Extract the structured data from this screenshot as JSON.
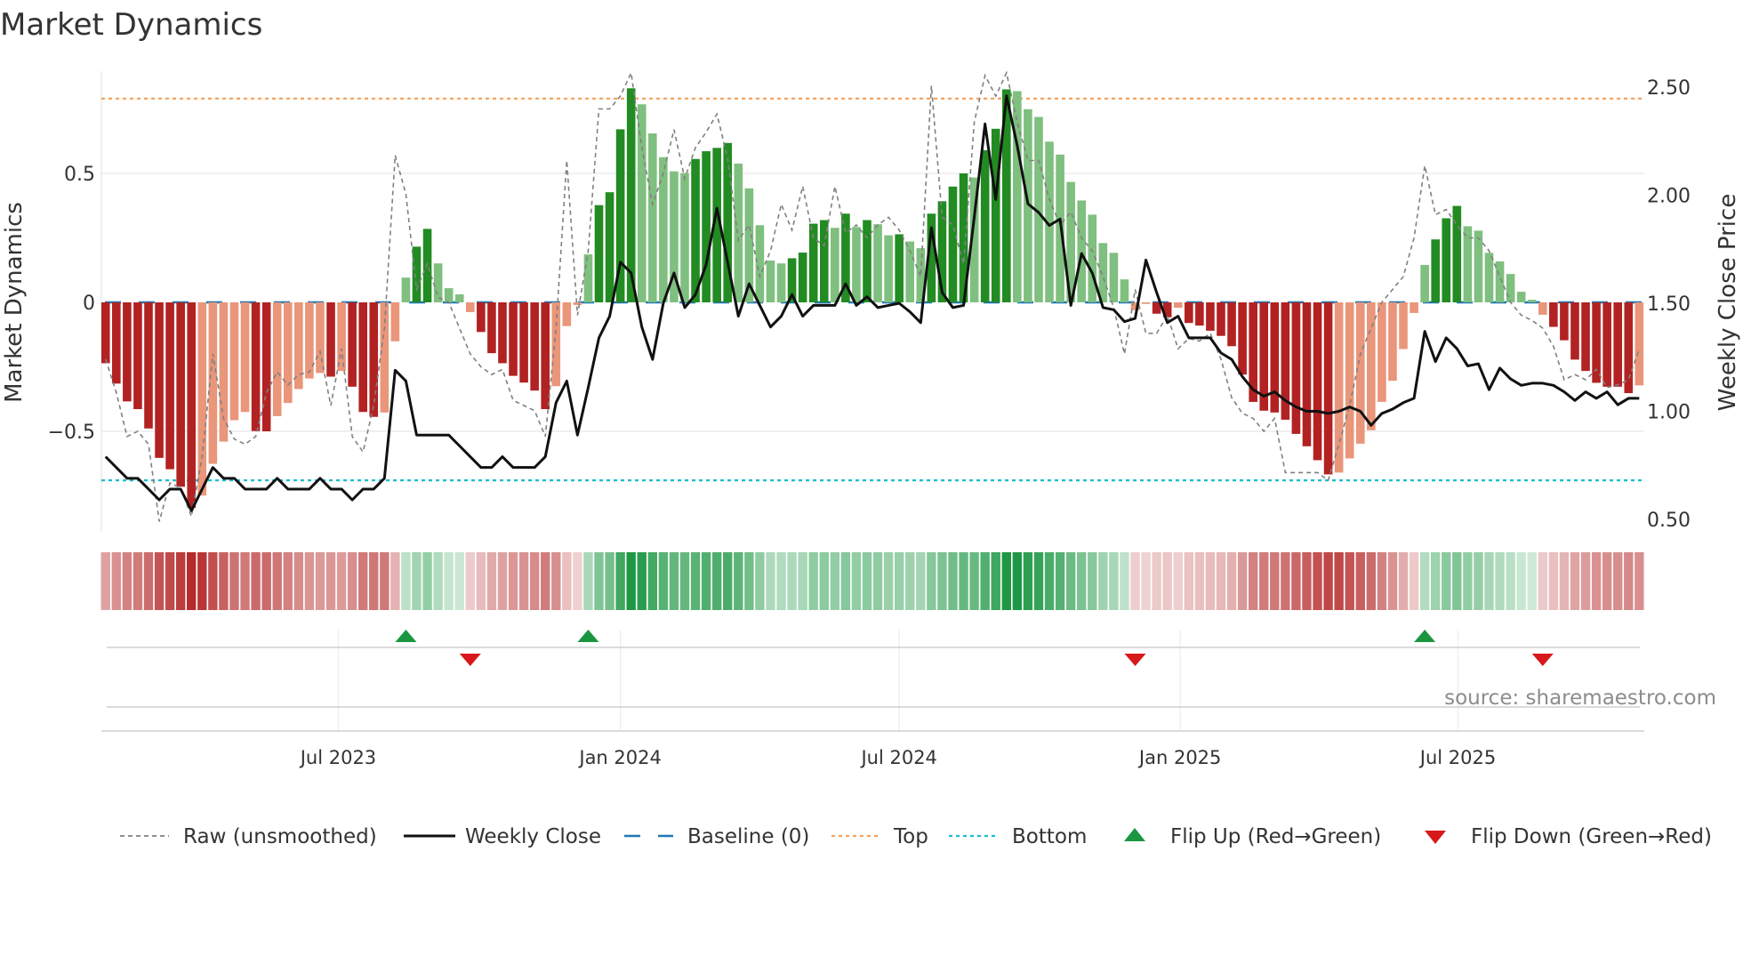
{
  "chart_data": {
    "type": "bar",
    "title": "Market Dynamics",
    "ylabel": "Market Dynamics",
    "y2label": "Weekly Close Price",
    "ylim": [
      -0.89,
      0.9
    ],
    "y2lim": [
      0.445,
      2.58
    ],
    "yticks": [
      {
        "label": "0.5",
        "value": 0.5
      },
      {
        "label": "0",
        "value": 0
      },
      {
        "label": "−0.5",
        "value": -0.5
      }
    ],
    "y2ticks": [
      {
        "label": "2.50",
        "value": 2.5
      },
      {
        "label": "2.00",
        "value": 2.0
      },
      {
        "label": "1.50",
        "value": 1.5
      },
      {
        "label": "1.00",
        "value": 1.0
      },
      {
        "label": "0.50",
        "value": 0.5
      }
    ],
    "xticks": [
      {
        "label": "Jul 2023",
        "week": 21.7
      },
      {
        "label": "Jan 2024",
        "week": 48.0
      },
      {
        "label": "Jul 2024",
        "week": 74.0
      },
      {
        "label": "Jan 2025",
        "week": 100.2
      },
      {
        "label": "Jul 2025",
        "week": 126.1
      }
    ],
    "grid": true,
    "top_level": 0.79,
    "bottom_level": -0.69,
    "baseline": 0,
    "dynamics": [
      -0.236,
      -0.315,
      -0.384,
      -0.414,
      -0.489,
      -0.603,
      -0.647,
      -0.715,
      -0.797,
      -0.749,
      -0.626,
      -0.54,
      -0.457,
      -0.425,
      -0.499,
      -0.5,
      -0.441,
      -0.39,
      -0.336,
      -0.295,
      -0.274,
      -0.288,
      -0.266,
      -0.327,
      -0.425,
      -0.444,
      -0.427,
      -0.151,
      0.096,
      0.216,
      0.285,
      0.151,
      0.055,
      0.031,
      -0.038,
      -0.115,
      -0.197,
      -0.236,
      -0.285,
      -0.311,
      -0.342,
      -0.414,
      -0.325,
      -0.092,
      -0.01,
      0.186,
      0.377,
      0.427,
      0.671,
      0.83,
      0.768,
      0.655,
      0.563,
      0.508,
      0.501,
      0.556,
      0.586,
      0.599,
      0.618,
      0.538,
      0.442,
      0.299,
      0.162,
      0.151,
      0.171,
      0.193,
      0.305,
      0.319,
      0.289,
      0.344,
      0.292,
      0.319,
      0.303,
      0.26,
      0.264,
      0.236,
      0.21,
      0.344,
      0.392,
      0.449,
      0.5,
      0.484,
      0.59,
      0.673,
      0.826,
      0.819,
      0.749,
      0.719,
      0.623,
      0.573,
      0.467,
      0.395,
      0.34,
      0.23,
      0.192,
      0.089,
      -0.03,
      -0.006,
      -0.044,
      -0.058,
      -0.021,
      -0.08,
      -0.09,
      -0.11,
      -0.13,
      -0.17,
      -0.28,
      -0.386,
      -0.42,
      -0.427,
      -0.455,
      -0.51,
      -0.558,
      -0.612,
      -0.667,
      -0.66,
      -0.605,
      -0.548,
      -0.496,
      -0.386,
      -0.304,
      -0.181,
      -0.041,
      0.145,
      0.244,
      0.326,
      0.374,
      0.295,
      0.278,
      0.192,
      0.159,
      0.11,
      0.041,
      0.01,
      -0.048,
      -0.095,
      -0.147,
      -0.222,
      -0.266,
      -0.312,
      -0.327,
      -0.327,
      -0.352,
      -0.322
    ],
    "raw": [
      -0.22,
      -0.35,
      -0.52,
      -0.5,
      -0.55,
      -0.85,
      -0.7,
      -0.72,
      -0.83,
      -0.6,
      -0.2,
      -0.45,
      -0.53,
      -0.55,
      -0.52,
      -0.35,
      -0.27,
      -0.32,
      -0.28,
      -0.27,
      -0.19,
      -0.4,
      -0.18,
      -0.52,
      -0.58,
      -0.4,
      -0.1,
      0.57,
      0.42,
      0.05,
      0.15,
      0.02,
      0.0,
      -0.1,
      -0.2,
      -0.25,
      -0.28,
      -0.26,
      -0.38,
      -0.4,
      -0.42,
      -0.52,
      -0.1,
      0.55,
      -0.05,
      0.2,
      0.75,
      0.75,
      0.8,
      0.89,
      0.6,
      0.38,
      0.5,
      0.67,
      0.48,
      0.6,
      0.66,
      0.73,
      0.56,
      0.24,
      0.3,
      0.1,
      0.2,
      0.38,
      0.28,
      0.45,
      0.25,
      0.22,
      0.45,
      0.27,
      0.3,
      0.25,
      0.3,
      0.33,
      0.28,
      0.2,
      0.1,
      0.84,
      0.33,
      0.3,
      0.15,
      0.7,
      0.88,
      0.8,
      0.89,
      0.7,
      0.55,
      0.55,
      0.4,
      0.3,
      0.35,
      0.25,
      0.2,
      0.1,
      -0.02,
      -0.2,
      0.05,
      -0.12,
      -0.12,
      -0.05,
      -0.18,
      -0.14,
      -0.15,
      -0.12,
      -0.22,
      -0.37,
      -0.43,
      -0.45,
      -0.5,
      -0.45,
      -0.66,
      -0.66,
      -0.66,
      -0.66,
      -0.69,
      -0.55,
      -0.4,
      -0.2,
      -0.1,
      0.0,
      0.05,
      0.1,
      0.25,
      0.53,
      0.34,
      0.36,
      0.3,
      0.25,
      0.25,
      0.2,
      0.1,
      0.0,
      -0.05,
      -0.07,
      -0.1,
      -0.17,
      -0.3,
      -0.28,
      -0.3,
      -0.26,
      -0.33,
      -0.32,
      -0.3,
      -0.18
    ],
    "weekly_close": [
      0.79,
      0.74,
      0.69,
      0.69,
      0.64,
      0.59,
      0.64,
      0.64,
      0.54,
      0.64,
      0.74,
      0.69,
      0.69,
      0.64,
      0.64,
      0.64,
      0.69,
      0.64,
      0.64,
      0.64,
      0.69,
      0.64,
      0.64,
      0.59,
      0.64,
      0.64,
      0.69,
      1.19,
      1.14,
      0.89,
      0.89,
      0.89,
      0.89,
      0.84,
      0.79,
      0.74,
      0.74,
      0.79,
      0.74,
      0.74,
      0.74,
      0.79,
      1.04,
      1.14,
      0.89,
      1.11,
      1.34,
      1.44,
      1.69,
      1.64,
      1.39,
      1.24,
      1.5,
      1.64,
      1.48,
      1.54,
      1.68,
      1.94,
      1.69,
      1.44,
      1.59,
      1.49,
      1.39,
      1.44,
      1.54,
      1.44,
      1.49,
      1.49,
      1.49,
      1.59,
      1.49,
      1.53,
      1.48,
      1.49,
      1.5,
      1.46,
      1.41,
      1.85,
      1.55,
      1.48,
      1.49,
      1.9,
      2.33,
      1.98,
      2.46,
      2.23,
      1.96,
      1.92,
      1.86,
      1.89,
      1.49,
      1.73,
      1.64,
      1.48,
      1.47,
      1.415,
      1.43,
      1.7,
      1.55,
      1.41,
      1.44,
      1.34,
      1.34,
      1.34,
      1.27,
      1.24,
      1.16,
      1.1,
      1.07,
      1.09,
      1.05,
      1.02,
      1.0,
      1.0,
      0.99,
      1.0,
      1.02,
      1.0,
      0.935,
      0.99,
      1.01,
      1.04,
      1.06,
      1.37,
      1.23,
      1.34,
      1.29,
      1.21,
      1.22,
      1.1,
      1.2,
      1.15,
      1.12,
      1.13,
      1.13,
      1.12,
      1.09,
      1.05,
      1.09,
      1.06,
      1.09,
      1.03,
      1.06,
      1.06
    ],
    "flip_up_weeks": [
      28,
      45,
      123
    ],
    "flip_down_weeks": [
      34,
      96,
      134
    ],
    "colors": {
      "strong_up": "#228b22",
      "weak_up": "#7fbf7f",
      "strong_down": "#b22222",
      "weak_down": "#e9967a",
      "baseline": "#1f77b4",
      "top": "#f4a460",
      "bottom": "#17becf",
      "close": "#111111",
      "raw": "#808080",
      "flip_up": "#1a9641",
      "flip_down": "#d7191c"
    },
    "legend": {
      "placement": "bottom",
      "items": [
        {
          "label": "Raw (unsmoothed)",
          "kind": "raw"
        },
        {
          "label": "Weekly Close",
          "kind": "close"
        },
        {
          "label": "Baseline (0)",
          "kind": "baseline"
        },
        {
          "label": "Top",
          "kind": "top"
        },
        {
          "label": "Bottom",
          "kind": "bottom"
        },
        {
          "label": "Flip Up (Red→Green)",
          "kind": "flip_up"
        },
        {
          "label": "Flip Down (Green→Red)",
          "kind": "flip_down"
        }
      ]
    },
    "annotation": "source: sharemaestro.com"
  }
}
